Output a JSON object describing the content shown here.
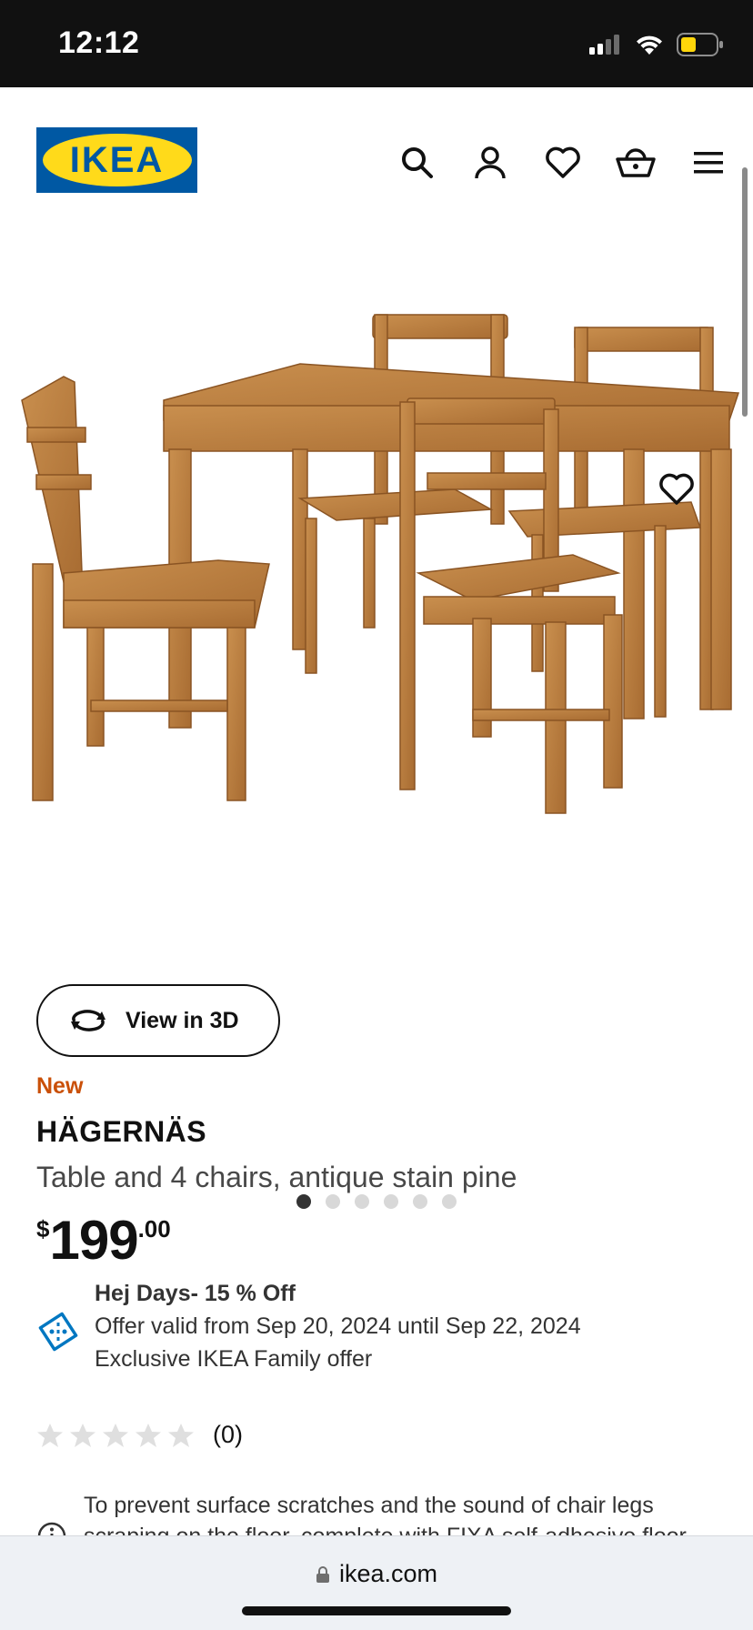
{
  "status_bar": {
    "time": "12:12",
    "icons": [
      "cellular-signal-icon",
      "wifi-icon",
      "battery-icon"
    ]
  },
  "header": {
    "logo_text": "IKEA",
    "icons": [
      "search-icon",
      "account-icon",
      "heart-icon",
      "shopping-basket-icon",
      "menu-icon"
    ]
  },
  "hero": {
    "save_icon": "heart-icon",
    "view3d_label": "View in 3D",
    "image_count": 6,
    "active_image": 1
  },
  "product": {
    "badge": "New",
    "name": "HÄGERNÄS",
    "description": "Table and 4 chairs, antique stain pine",
    "price": {
      "currency": "$",
      "integer": "199",
      "decimal": ".00"
    }
  },
  "offer": {
    "title": "Hej Days- 15 % Off",
    "validity": "Offer valid from Sep 20, 2024 until Sep 22, 2024",
    "note": "Exclusive IKEA Family offer"
  },
  "rating": {
    "stars": 0,
    "count_label": "(0)"
  },
  "info": {
    "line1": "To prevent surface scratches and the sound of chair legs",
    "line2": "scraping on the floor, complete with FIXA self-adhesive floor"
  },
  "browser": {
    "url": "ikea.com"
  },
  "colors": {
    "ikea_blue": "#0058a3",
    "ikea_yellow": "#ffda1a",
    "new_badge": "#ca5008",
    "offer_icon": "#0077c1",
    "wood": "#b77a3f"
  }
}
